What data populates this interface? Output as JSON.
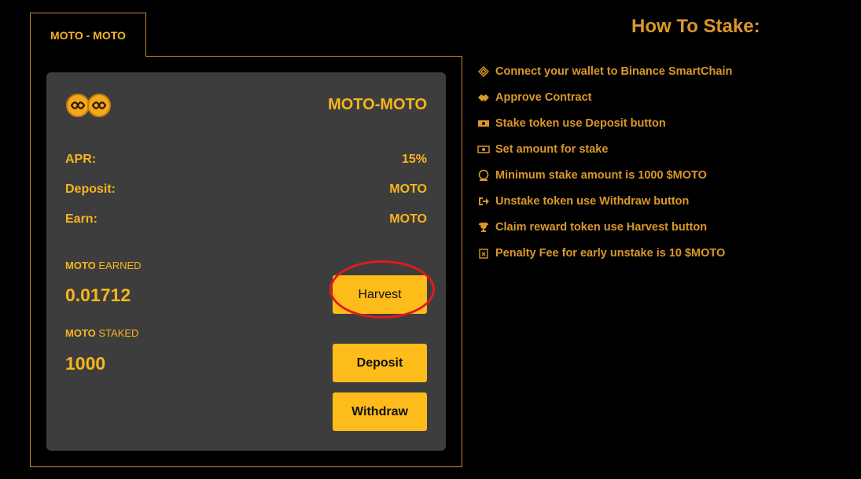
{
  "tab": {
    "label": "MOTO - MOTO"
  },
  "card": {
    "pair": "MOTO-MOTO",
    "rows": [
      {
        "label": "APR:",
        "value": "15%"
      },
      {
        "label": "Deposit:",
        "value": "MOTO"
      },
      {
        "label": "Earn:",
        "value": "MOTO"
      }
    ],
    "earned": {
      "token": "MOTO",
      "suffix": " EARNED",
      "value": "0.01712"
    },
    "staked": {
      "token": "MOTO",
      "suffix": " STAKED",
      "value": "1000"
    },
    "buttons": {
      "harvest": "Harvest",
      "deposit": "Deposit",
      "withdraw": "Withdraw"
    }
  },
  "howto": {
    "title": "How To Stake:",
    "steps": [
      {
        "icon": "binance-icon",
        "text": "Connect your wallet to Binance SmartChain"
      },
      {
        "icon": "handshake-icon",
        "text": "Approve Contract"
      },
      {
        "icon": "money-icon",
        "text": "Stake token use Deposit button"
      },
      {
        "icon": "cash-icon",
        "text": "Set amount for stake"
      },
      {
        "icon": "coin-icon",
        "text": "Minimum stake amount is 1000 $MOTO"
      },
      {
        "icon": "exit-icon",
        "text": "Unstake token use Withdraw button"
      },
      {
        "icon": "trophy-icon",
        "text": "Claim reward token use Harvest button"
      },
      {
        "icon": "calendar-x-icon",
        "text": "Penalty Fee for early unstake is 10 $MOTO"
      }
    ]
  },
  "colors": {
    "accent": "#f7b51e",
    "button": "#fdbc1a",
    "card": "#3d3d3d",
    "border": "#c9892a",
    "highlight": "#e01b1b"
  }
}
